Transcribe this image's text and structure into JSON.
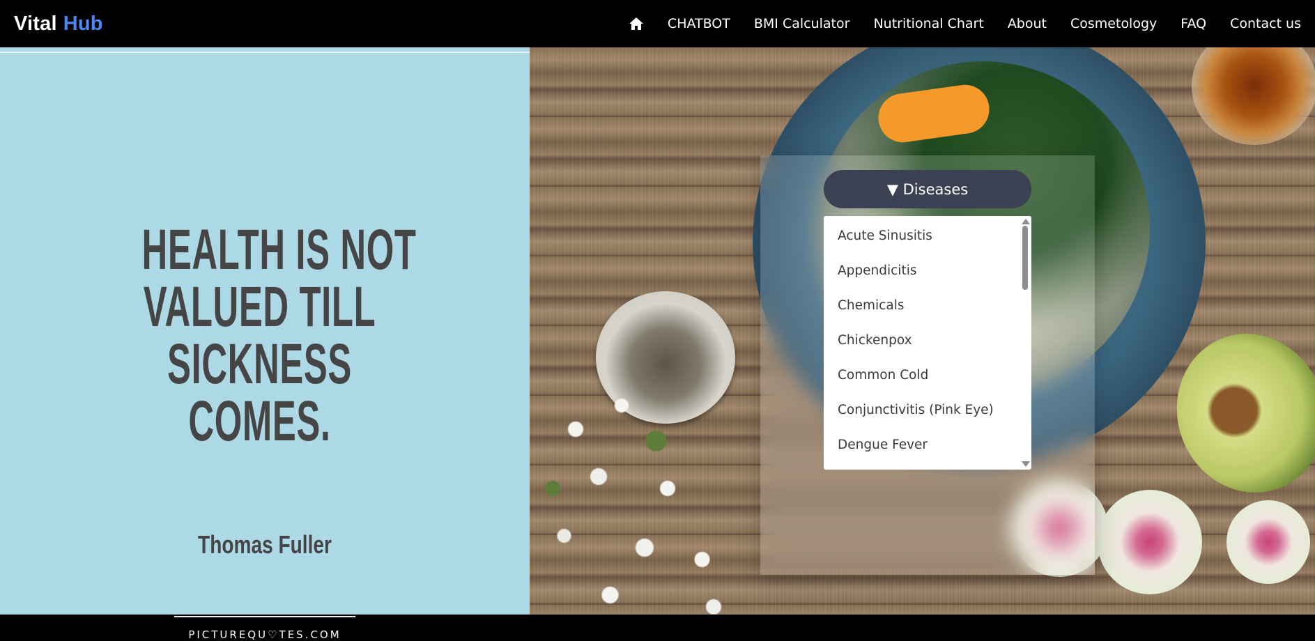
{
  "navbar": {
    "brand_part1": "Vital",
    "brand_part2": "Hub",
    "brand_accent_color": "#4f86f7",
    "home_icon": "home-icon",
    "links": [
      {
        "label": "CHATBOT"
      },
      {
        "label": "BMI Calculator"
      },
      {
        "label": "Nutritional Chart"
      },
      {
        "label": "About"
      },
      {
        "label": "Cosmetology"
      },
      {
        "label": "FAQ"
      },
      {
        "label": "Contact us"
      }
    ]
  },
  "quote": {
    "lines": [
      "HEALTH IS NOT",
      "VALUED TILL",
      "SICKNESS",
      "COMES."
    ],
    "author": "Thomas Fuller",
    "watermark": "PICTUREQU♡TES.COM",
    "background_color": "#add8e6"
  },
  "dropdown": {
    "toggle_label": "▼ Diseases",
    "toggle_color": "#3b4153",
    "items": [
      "Acute Sinusitis",
      "Appendicitis",
      "Chemicals",
      "Chickenpox",
      "Common Cold",
      "Conjunctivitis (Pink Eye)",
      "Dengue Fever"
    ]
  }
}
